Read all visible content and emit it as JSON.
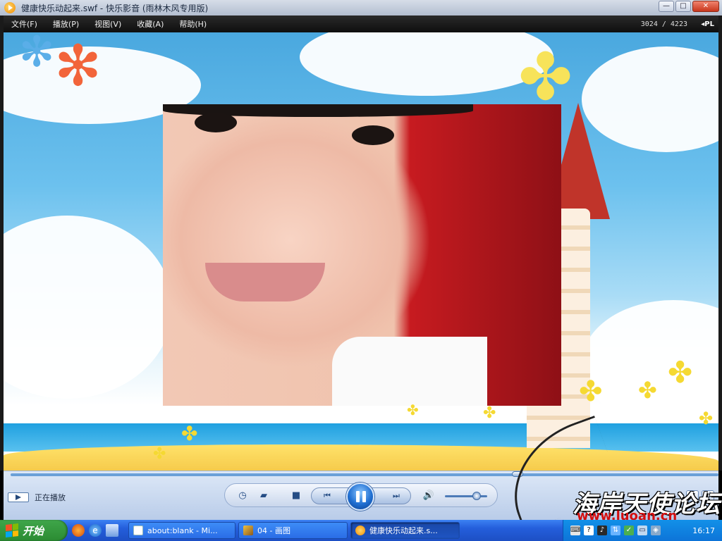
{
  "window": {
    "title": "健康快乐动起来.swf - 快乐影音 (雨林木风专用版)",
    "buttons": {
      "minimize": "—",
      "maximize": "□",
      "close": "✕"
    }
  },
  "menu": {
    "items": [
      "文件(F)",
      "播放(P)",
      "视图(V)",
      "收藏(A)",
      "帮助(H)"
    ],
    "frame_counter": "3024 / 4223",
    "playlist_toggle": "◂PL"
  },
  "player": {
    "seek_fraction": 0.716,
    "volume_fraction": 0.75,
    "status_text": "正在播放"
  },
  "watermark": {
    "logo_text": "海岸天使论坛",
    "url": "www.luoan.cn"
  },
  "taskbar": {
    "start_label": "开始",
    "tasks": [
      {
        "label": "about:blank - Mi...",
        "active": false
      },
      {
        "label": "04 - 画图",
        "active": false
      },
      {
        "label": "健康快乐动起来.s...",
        "active": true
      }
    ],
    "clock": "16:17"
  },
  "colors": {
    "taskbar_blue": "#245edb",
    "start_green": "#2b8b32",
    "menubar_black": "#0e0e0e",
    "watermark_red": "#d30e0e"
  },
  "icons": {
    "app": "player-logo-icon",
    "status": "play-indicator-icon",
    "quick_launch": [
      "firefox-icon",
      "ie-icon",
      "show-desktop-icon"
    ]
  }
}
